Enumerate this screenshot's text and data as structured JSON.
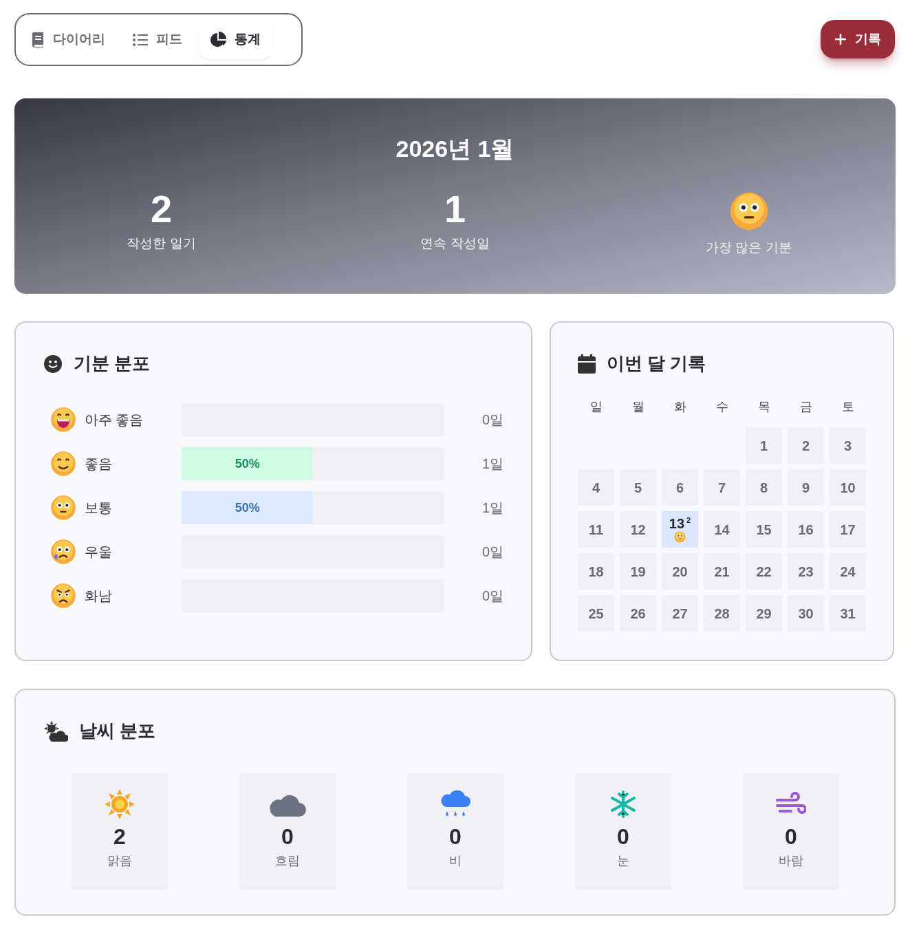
{
  "nav": {
    "tabs": [
      {
        "label": "다이어리",
        "kind": "book",
        "selected": false
      },
      {
        "label": "피드",
        "kind": "list",
        "selected": false
      },
      {
        "label": "통계",
        "kind": "pie",
        "selected": true
      }
    ],
    "add_button": "기록"
  },
  "summary": {
    "title": "2026년 1월",
    "stats": [
      {
        "kind": "number",
        "value": "2",
        "label": "작성한 일기"
      },
      {
        "kind": "number",
        "value": "1",
        "label": "연속 작성일"
      },
      {
        "kind": "neutral",
        "label": "가장 많은 기분"
      }
    ]
  },
  "mood_distribution": {
    "title": "기분 분포",
    "rows": [
      {
        "kind": "great",
        "label": "아주 좋음",
        "count": "0일"
      },
      {
        "kind": "good",
        "label": "좋음",
        "level": 0.5,
        "percent": "50%",
        "count": "1일",
        "color": "#d1fae5"
      },
      {
        "kind": "neutral",
        "label": "보통",
        "level": 0.5,
        "percent": "50%",
        "count": "1일",
        "color": "#dbeafe"
      },
      {
        "kind": "sad",
        "label": "우울",
        "count": "0일"
      },
      {
        "kind": "angry",
        "label": "화남",
        "count": "0일"
      }
    ]
  },
  "calendar": {
    "title": "이번 달 기록",
    "weekdays": [
      "일",
      "월",
      "화",
      "수",
      "목",
      "금",
      "토"
    ],
    "weeks": [
      {
        "days": [
          {
            "day": "1"
          },
          {
            "day": "2"
          },
          {
            "day": "3"
          }
        ]
      },
      {
        "days": [
          {
            "day": "4"
          },
          {
            "day": "5"
          },
          {
            "day": "6"
          },
          {
            "day": "7"
          },
          {
            "day": "8"
          },
          {
            "day": "9"
          },
          {
            "day": "10"
          }
        ]
      },
      {
        "days": [
          {
            "day": "11"
          },
          {
            "day": "12"
          },
          {
            "day": "13",
            "count": "2",
            "kind": "neutral"
          },
          {
            "day": "14"
          },
          {
            "day": "15"
          },
          {
            "day": "16"
          },
          {
            "day": "17"
          }
        ]
      },
      {
        "days": [
          {
            "day": "18"
          },
          {
            "day": "19"
          },
          {
            "day": "20"
          },
          {
            "day": "21"
          },
          {
            "day": "22"
          },
          {
            "day": "23"
          },
          {
            "day": "24"
          }
        ]
      },
      {
        "days": [
          {
            "day": "25"
          },
          {
            "day": "26"
          },
          {
            "day": "27"
          },
          {
            "day": "28"
          },
          {
            "day": "29"
          },
          {
            "day": "30"
          },
          {
            "day": "31"
          }
        ]
      }
    ]
  },
  "weather_distribution": {
    "title": "날씨 분포",
    "items": [
      {
        "kind": "sunny",
        "count": "2",
        "label": "맑음"
      },
      {
        "kind": "cloudy",
        "count": "0",
        "label": "흐림"
      },
      {
        "kind": "rain",
        "count": "0",
        "label": "비"
      },
      {
        "kind": "snow",
        "count": "0",
        "label": "눈"
      },
      {
        "kind": "wind",
        "count": "0",
        "label": "바람"
      }
    ]
  }
}
